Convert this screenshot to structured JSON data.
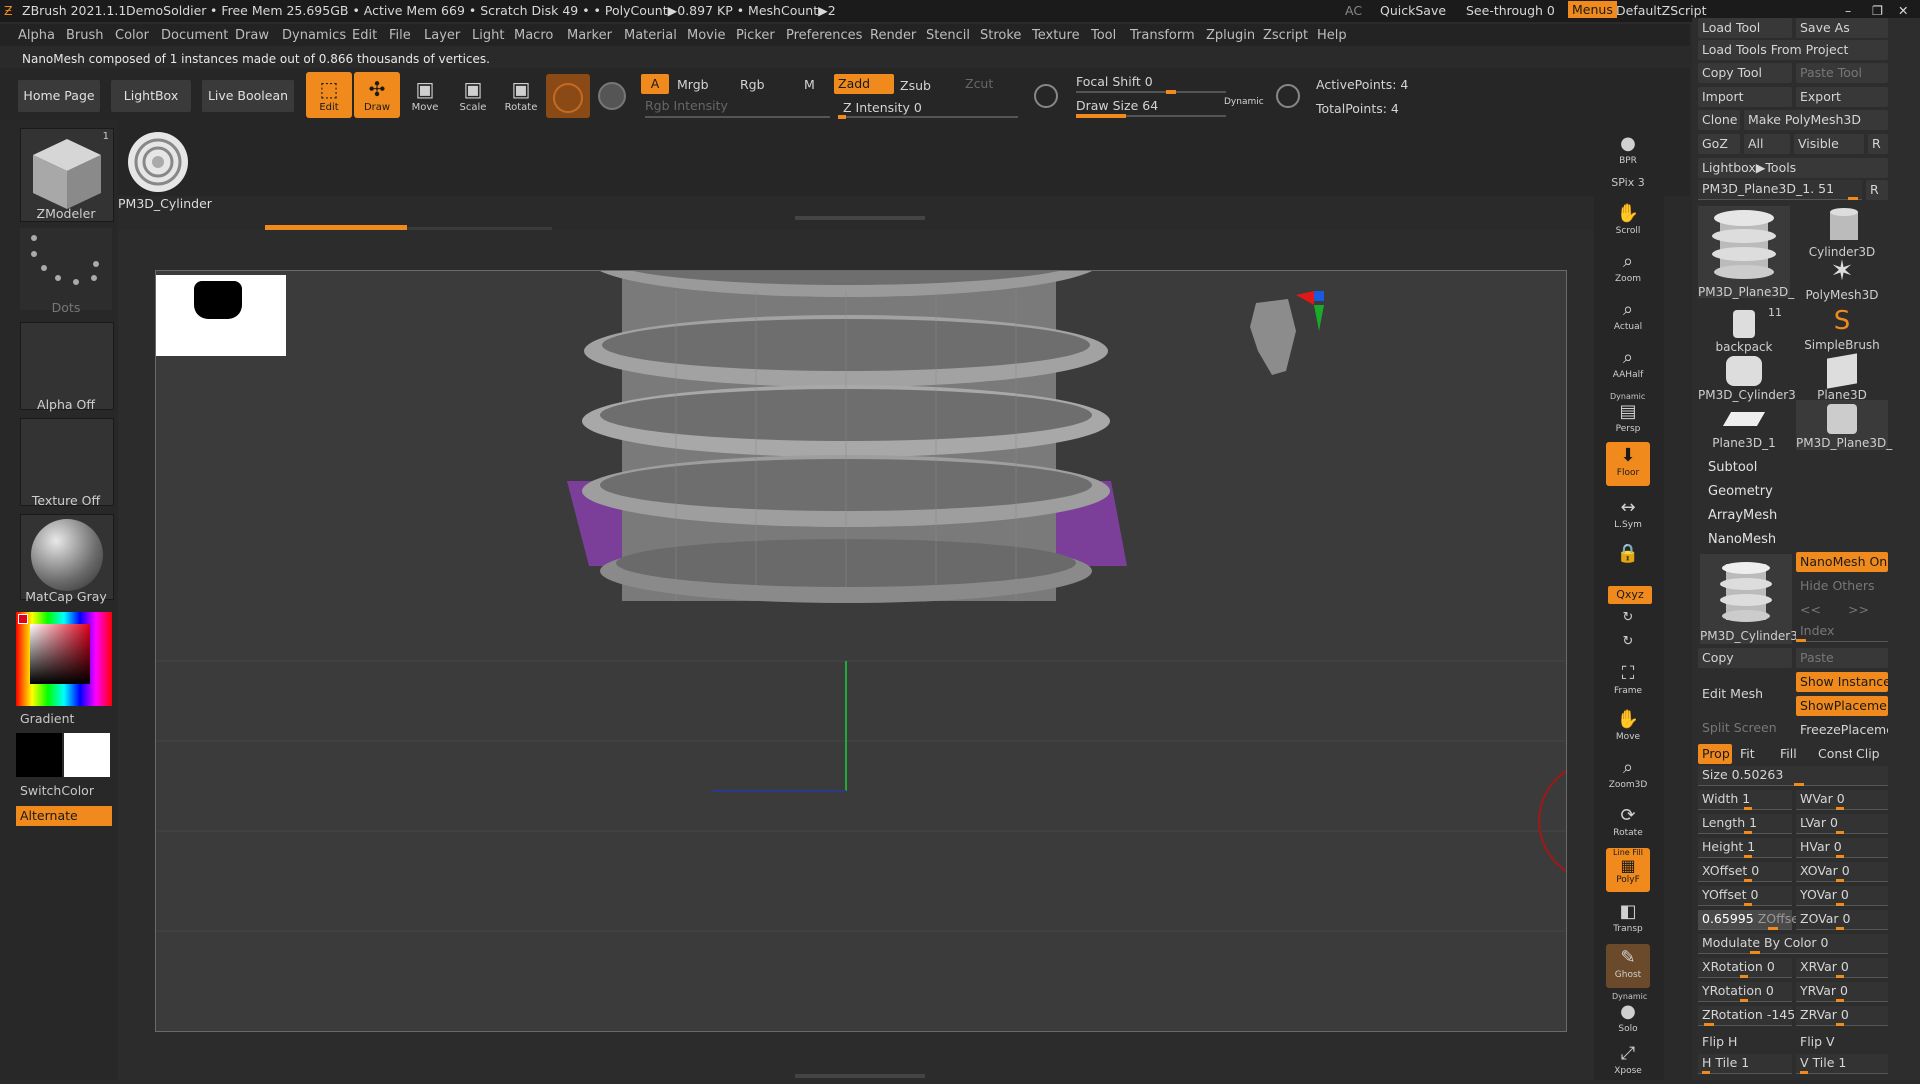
{
  "titlebar": {
    "app": "ZBrush 2021.1.1",
    "project": "DemoSoldier",
    "stats": "• Free Mem 25.695GB • Active Mem 669 • Scratch Disk 49 • • PolyCount▶0.897 KP • MeshCount▶2",
    "ac": "AC",
    "quicksave": "QuickSave",
    "seethrough": "See-through  0",
    "menus": "Menus",
    "script": "DefaultZScript"
  },
  "menu": [
    "Alpha",
    "Brush",
    "Color",
    "Document",
    "Draw",
    "Dynamics",
    "Edit",
    "File",
    "Layer",
    "Light",
    "Macro",
    "Marker",
    "Material",
    "Movie",
    "Picker",
    "Preferences",
    "Render",
    "Stencil",
    "Stroke",
    "Texture",
    "Tool",
    "Transform",
    "Zplugin",
    "Zscript",
    "Help"
  ],
  "note": "NanoMesh composed of 1 instances made out of 0.866 thousands of vertices.",
  "toolbar": {
    "home": "Home Page",
    "lightbox": "LightBox",
    "liveboolean": "Live Boolean",
    "edit": "Edit",
    "draw": "Draw",
    "move": "Move",
    "scale": "Scale",
    "rotate": "Rotate",
    "a": "A",
    "mrgb": "Mrgb",
    "rgb": "Rgb",
    "m": "M",
    "rgb_intensity": "Rgb Intensity",
    "zadd": "Zadd",
    "zsub": "Zsub",
    "zcut": "Zcut",
    "z_intensity": "Z Intensity 0",
    "focal_shift": "Focal Shift 0",
    "draw_size": "Draw Size 64",
    "dynamic": "Dynamic",
    "active_points": "ActivePoints: 4",
    "total_points": "TotalPoints: 4"
  },
  "left": {
    "zmodeler": "ZModeler",
    "zmodeler_count": "1",
    "pm3d": "PM3D_Cylinder",
    "dots": "Dots",
    "alpha": "Alpha Off",
    "texture": "Texture Off",
    "matcap": "MatCap Gray",
    "gradient": "Gradient",
    "switchcolor": "SwitchColor",
    "alternate": "Alternate"
  },
  "nav": [
    "BPR",
    "SPix 3",
    "Scroll",
    "Zoom",
    "Actual",
    "AAHalf",
    "Persp",
    "Floor",
    "L.Sym",
    "",
    "Qxyz",
    "",
    "",
    "Frame",
    "Move",
    "Zoom3D",
    "Rotate",
    "PolyF",
    "Transp",
    "Ghost",
    "Solo",
    "Xpose"
  ],
  "nav_dynamic": "Dynamic",
  "nav_linefill": "Line Fill",
  "tool": {
    "load_tool": "Load Tool",
    "save_as": "Save As",
    "load_from_project": "Load Tools From Project",
    "copy_tool": "Copy Tool",
    "paste_tool": "Paste Tool",
    "import": "Import",
    "export": "Export",
    "clone": "Clone",
    "make_polymesh": "Make PolyMesh3D",
    "goz": "GoZ",
    "all": "All",
    "visible": "Visible",
    "r": "R",
    "lightbox_tools": "Lightbox▶Tools",
    "current": "PM3D_Plane3D_1. 51",
    "cells": [
      "PM3D_Plane3D_",
      "Cylinder3D",
      "",
      "PolyMesh3D",
      "backpack",
      "SimpleBrush",
      "PM3D_Cylinder3",
      "Plane3D",
      "Plane3D_1",
      "PM3D_Plane3D_"
    ],
    "backpack_count": "11",
    "subtool": "Subtool",
    "geometry": "Geometry",
    "arraymesh": "ArrayMesh",
    "nanomesh": "NanoMesh",
    "nanomesh_on": "NanoMesh On",
    "hide_others": "Hide Others",
    "prev": "<<",
    "next": ">>",
    "nano_thumb": "PM3D_Cylinder3",
    "index": "Index",
    "copy": "Copy",
    "paste": "Paste",
    "show_instances": "Show Instances",
    "edit_mesh": "Edit Mesh",
    "show_placement": "ShowPlacement",
    "split_screen": "Split Screen",
    "freeze_placement": "FreezePlacemer",
    "prop": "Prop",
    "fit": "Fit",
    "fill": "Fill",
    "const": "Const",
    "clip": "Clip",
    "size": "Size 0.50263",
    "width": "Width 1",
    "wvar": "WVar 0",
    "length": "Length 1",
    "lvar": "LVar 0",
    "height": "Height 1",
    "hvar": "HVar 0",
    "xoffset": "XOffset 0",
    "xovar": "XOVar 0",
    "yoffset": "YOffset 0",
    "yovar": "YOVar 0",
    "zoffset_val": "0.65995",
    "zoffset": "ZOffset",
    "zovar": "ZOVar 0",
    "modulate": "Modulate By Color 0",
    "xrotation": "XRotation 0",
    "xrvar": "XRVar 0",
    "yrotation": "YRotation 0",
    "yrvar": "YRVar 0",
    "zrotation": "ZRotation -145",
    "zrvar": "ZRVar 0",
    "fliph": "Flip H",
    "flipv": "Flip V",
    "htile": "H Tile 1",
    "vtile": "V Tile 1"
  },
  "colors": {
    "accent": "#f08a1c",
    "purple": "#7b3f9a"
  }
}
